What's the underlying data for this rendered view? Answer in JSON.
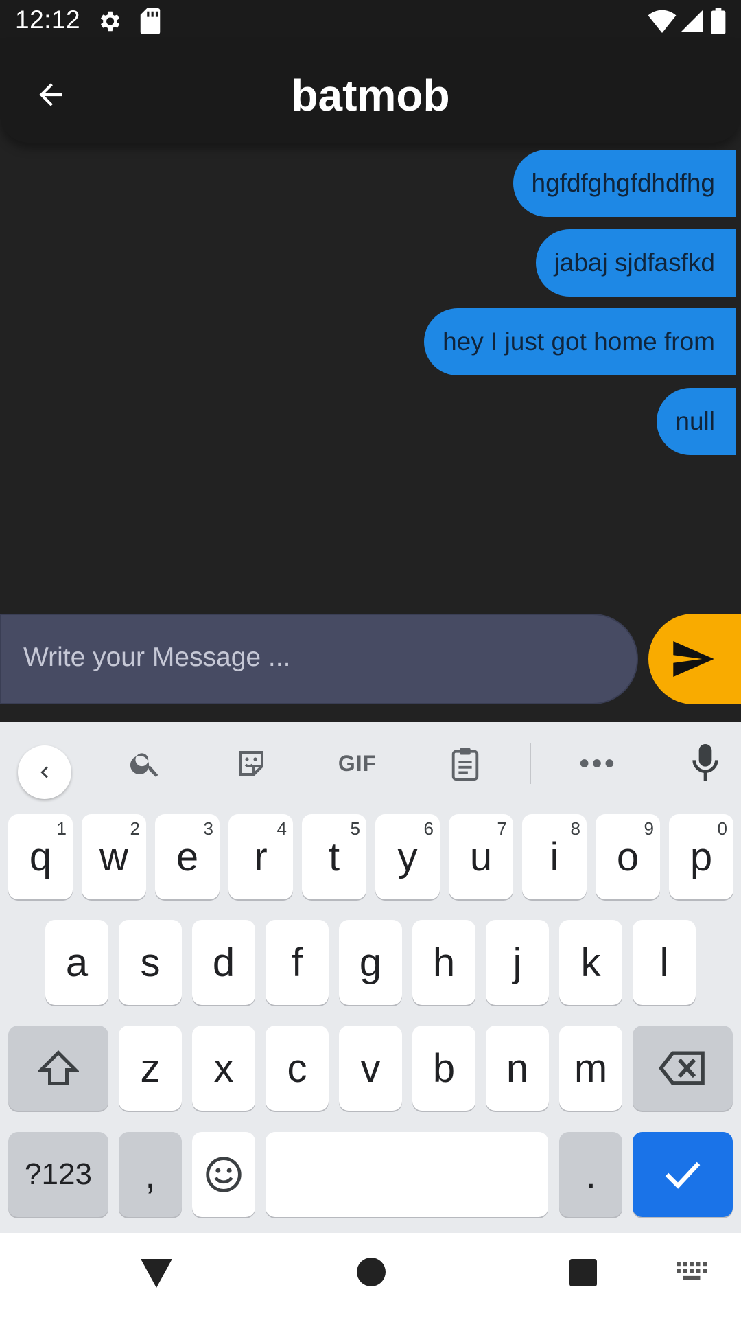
{
  "status_bar": {
    "time": "12:12",
    "icons": [
      "gear-icon",
      "sd-card-icon",
      "wifi-icon",
      "signal-icon",
      "battery-icon"
    ]
  },
  "app_bar": {
    "title": "batmob",
    "back_icon": "arrow-left-icon"
  },
  "messages": [
    {
      "text": "hgfdfghgfdhdfhg",
      "direction": "outgoing"
    },
    {
      "text": "jabaj sjdfasfkd",
      "direction": "outgoing"
    },
    {
      "text": "hey I just got home from",
      "direction": "outgoing"
    },
    {
      "text": "null",
      "direction": "outgoing"
    }
  ],
  "composer": {
    "placeholder": "Write your Message ...",
    "value": "",
    "send_icon": "send-icon"
  },
  "keyboard": {
    "toolbar": [
      "chevron-left-icon",
      "search-icon",
      "sticker-icon",
      "gif-icon",
      "clipboard-icon",
      "more-icon",
      "mic-icon"
    ],
    "gif_label": "GIF",
    "row1": [
      {
        "label": "q",
        "hint": "1"
      },
      {
        "label": "w",
        "hint": "2"
      },
      {
        "label": "e",
        "hint": "3"
      },
      {
        "label": "r",
        "hint": "4"
      },
      {
        "label": "t",
        "hint": "5"
      },
      {
        "label": "y",
        "hint": "6"
      },
      {
        "label": "u",
        "hint": "7"
      },
      {
        "label": "i",
        "hint": "8"
      },
      {
        "label": "o",
        "hint": "9"
      },
      {
        "label": "p",
        "hint": "0"
      }
    ],
    "row2": [
      "a",
      "s",
      "d",
      "f",
      "g",
      "h",
      "j",
      "k",
      "l"
    ],
    "row3": [
      "z",
      "x",
      "c",
      "v",
      "b",
      "n",
      "m"
    ],
    "symbols_label": "?123",
    "comma_label": ",",
    "period_label": "."
  },
  "nav_bar": {
    "icons": [
      "back-triangle-icon",
      "home-circle-icon",
      "recents-square-icon",
      "keyboard-switch-icon"
    ]
  },
  "colors": {
    "background": "#222222",
    "bubble": "#1e88e5",
    "send": "#f9ab00",
    "input": "#474b63",
    "enter_key": "#1a73e8"
  }
}
